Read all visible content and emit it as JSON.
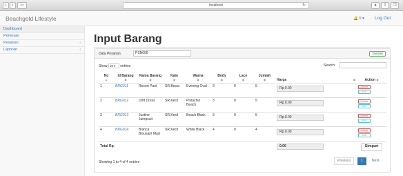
{
  "browser": {
    "url": "localhost"
  },
  "navbar": {
    "brand": "Beachgold Lifestyle",
    "logout": "Log Out",
    "alert_count": "0"
  },
  "sidebar": {
    "items": [
      {
        "label": "Dashboard",
        "active": true
      },
      {
        "label": "Pemesan"
      },
      {
        "label": "Pesanan",
        "caret": true
      },
      {
        "label": "Laporan",
        "caret": true
      }
    ]
  },
  "page": {
    "title": "Input Barang"
  },
  "form": {
    "data_pesanan_label": "Data Pesanan",
    "data_pesanan_value": "PSN008",
    "tambah_label": "Tambah",
    "show_prefix": "Show",
    "show_value": "10",
    "show_suffix": "entries",
    "search_label": "Search:"
  },
  "table": {
    "headers": [
      "No",
      "Id Barang",
      "Nama Barang",
      "Kain",
      "Warna",
      "Body",
      "Lace",
      "Jumlah",
      "Harga",
      "Action"
    ],
    "rows": [
      {
        "no": "1",
        "id": "BRG011",
        "nama": "Resort Pant",
        "kain": "SR.Besar",
        "warna": "Evening Oval",
        "body": "3",
        "lace": "0",
        "jumlah": "5",
        "harga": "Rp.0.00"
      },
      {
        "no": "2",
        "id": "BRG012",
        "nama": "Drift Dress",
        "kain": "SR.Kecil",
        "warna": "Pistachio Beach",
        "body": "3",
        "lace": "0",
        "jumlah": "5",
        "harga": "Rp.0.00"
      },
      {
        "no": "3",
        "id": "BRG013",
        "nama": "Justine Jumpsuit",
        "kain": "SR.Kecil",
        "warna": "Beach Black",
        "body": "3",
        "lace": "0",
        "jumlah": "5",
        "harga": "Rp.0.00"
      },
      {
        "no": "4",
        "id": "BRG014",
        "nama": "Bianca Blousant Maxi",
        "kain": "SR.Kecil",
        "warna": "White Black",
        "body": "4",
        "lace": "0",
        "jumlah": "4",
        "harga": "Rp.0.00"
      }
    ],
    "action_delete": "Delete",
    "action_edit": "Edit",
    "total_label": "Total Rp.",
    "total_value": "0.00",
    "simpan_label": "Simpan"
  },
  "footer": {
    "showing": "Showing 1 to 4 of 4 entries",
    "previous": "Previous",
    "page": "1",
    "next": "Next"
  },
  "colors": {
    "link": "#337ab7",
    "danger": "#d9534f",
    "info": "#5bc0de",
    "success": "#5cb85c"
  }
}
